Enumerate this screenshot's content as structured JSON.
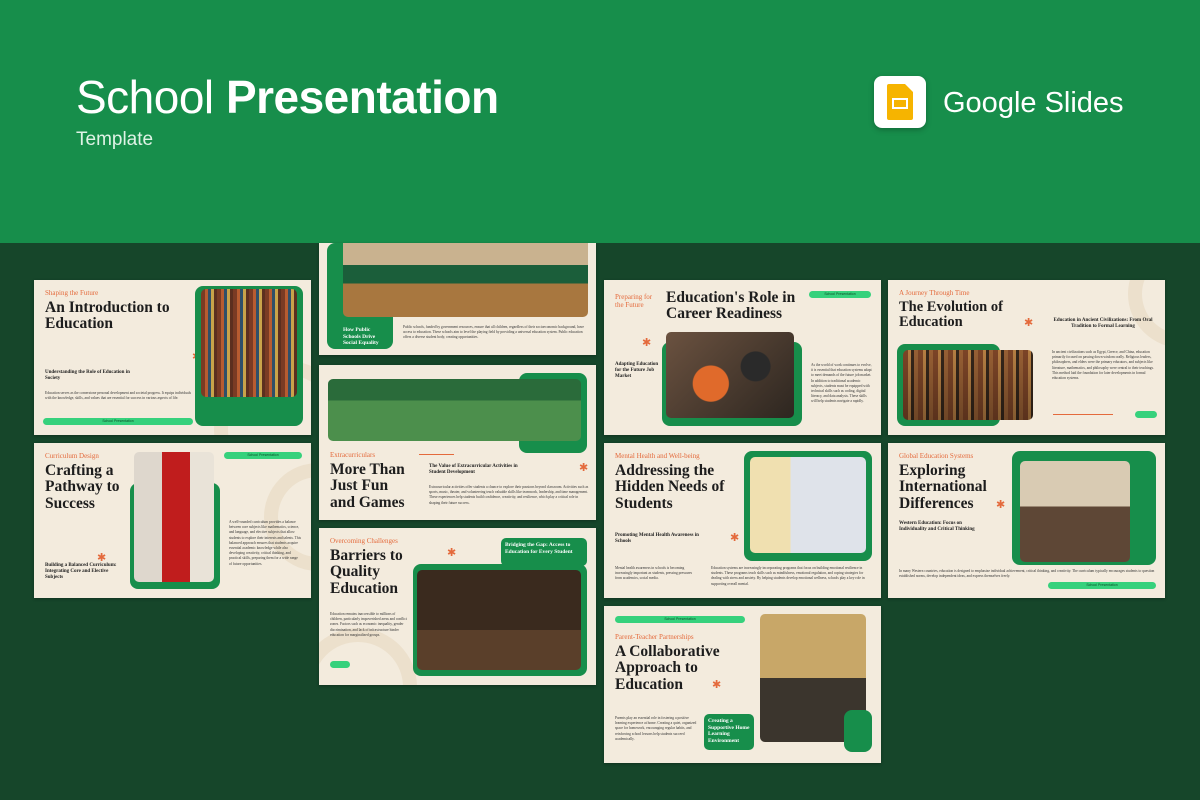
{
  "header": {
    "title_light": "School",
    "title_bold": "Presentation",
    "subtitle": "Template",
    "platform_label": "Google Slides",
    "platform_icon": "google-slides-icon"
  },
  "colors": {
    "banner": "#178e4b",
    "background": "#16462a",
    "slide": "#f3ebdd",
    "accent": "#e46a3c",
    "pill": "#36d17c"
  },
  "slides": {
    "intro": {
      "kicker": "Shaping the Future",
      "title": "An Introduction to Education",
      "sub": "Understanding the Role of Education in Society",
      "body": "Education serves as the cornerstone personal development and societal progress. It equips individuals with the knowledge, skills, and values that are essential for success in various aspects of life.",
      "pill": "School Presentation"
    },
    "public": {
      "caption": "How Public Schools Drive Social Equality",
      "body": "Public schools, funded by government resources, ensure that all children, regardless of their socioeconomic background, have access to education. These schools aim to level the playing field by providing a universal education system. Public education offers a diverse student body, creating opportunities."
    },
    "extra": {
      "kicker": "Extracurriculars",
      "title": "More Than Just Fun and Games",
      "sub": "The Value of Extracurricular Activities in Student Development",
      "body": "Extracurricular activities offer students a chance to explore their passions beyond classroom. Activities such as sports, music, theater, and volunteering teach valuable skills like teamwork, leadership, and time management. These experiences help students build confidence, creativity, and resilience, which play a critical role in shaping their future success."
    },
    "barriers": {
      "kicker": "Overcoming Challenges",
      "title": "Barriers to Quality Education",
      "box": "Bridging the Gap: Access to Education for Every Student",
      "body": "Education remains inaccessible to millions of children, particularly impoverished areas and conflict zones. Factors such as economic inequality, gender discrimination, and lack of infrastructure hinder education for marginalized groups."
    },
    "career": {
      "kicker": "Preparing for the Future",
      "title": "Education's Role in Career Readiness",
      "sub": "Adapting Education for the Future Job Market",
      "body": "As the world of work continues to evolve, it is essential that education systems adapt to meet demands of the future job market. In addition to traditional academic subjects, students must be equipped with technical skills such as coding, digital literacy, and data analysis. These skills will help students navigate a rapidly.",
      "pill": "School Presentation"
    },
    "evolution": {
      "kicker": "A Journey Through Time",
      "title": "The Evolution of Education",
      "sub": "Education in Ancient Civilizations: From Oral Tradition to Formal Learning",
      "body": "In ancient civilizations such as Egypt, Greece, and China, education primarily focused on passing down wisdom orally. Religious leaders, philosophers, and elders were the primary educators, and subjects like literature, mathematics, and philosophy were central to their teachings. This method laid the foundation for later developments in formal education systems."
    },
    "curriculum": {
      "kicker": "Curriculum Design",
      "title": "Crafting a Pathway to Success",
      "sub": "Building a Balanced Curriculum: Integrating Core and Elective Subjects",
      "body": "A well-rounded curriculum provides a balance between core subjects like mathematics, science, and language, and elective subjects that allow students to explore their interests and talents. This balanced approach ensures that students acquire essential academic knowledge while also developing creativity, critical thinking, and practical skills, preparing them for a wide range of future opportunities.",
      "pill": "School Presentation"
    },
    "mental": {
      "kicker": "Mental Health and Well-being",
      "title": "Addressing the Hidden Needs of Students",
      "sub": "Promoting Mental Health Awareness in Schools",
      "body1": "Mental health awareness in schools is becoming increasingly important as students, pressing pressures from academics, social media.",
      "body2": "Education systems are increasingly incorporating programs that focus on building emotional resilience in students. These programs teach skills such as mindfulness, emotional regulation, and coping strategies for dealing with stress and anxiety. By helping students develop emotional wellness, schools play a key role in supporting overall mental."
    },
    "global": {
      "kicker": "Global Education Systems",
      "title": "Exploring International Differences",
      "sub": "Western Education: Focus on Individuality and Critical Thinking",
      "body": "In many Western countries, education is designed to emphasize individual achievement, critical thinking, and creativity. The curriculum typically encourages students to question established norms, develop independent ideas, and express themselves freely.",
      "pill": "School Presentation"
    },
    "parent": {
      "kicker": "Parent-Teacher Partnerships",
      "title": "A Collaborative Approach to Education",
      "box": "Creating a Supportive Home Learning Environment",
      "body": "Parents play an essential role in fostering a positive learning experience at home. Creating a quiet, organized space for homework, encouraging regular habits, and reinforcing school lessons help students succeed academically.",
      "pill": "School Presentation"
    }
  }
}
